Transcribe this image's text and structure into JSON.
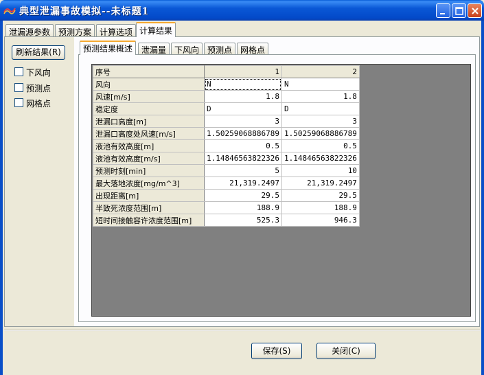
{
  "window": {
    "title": "典型泄漏事故模拟--未标题1"
  },
  "top_tabs": [
    {
      "label": "泄漏源参数"
    },
    {
      "label": "预测方案"
    },
    {
      "label": "计算选项"
    },
    {
      "label": "计算结果"
    }
  ],
  "left": {
    "refresh_label": "刷新结果(R)",
    "checkboxes": [
      {
        "label": "下风向",
        "checked": false
      },
      {
        "label": "预测点",
        "checked": false
      },
      {
        "label": "网格点",
        "checked": false
      }
    ]
  },
  "inner_tabs": [
    {
      "label": "预测结果概述"
    },
    {
      "label": "泄漏量"
    },
    {
      "label": "下风向"
    },
    {
      "label": "预测点"
    },
    {
      "label": "网格点"
    }
  ],
  "grid": {
    "header": {
      "label": "序号",
      "cols": [
        "1",
        "2"
      ]
    },
    "rows": [
      {
        "label": "风向",
        "values": [
          "N",
          "N"
        ]
      },
      {
        "label": "风速[m/s]",
        "values": [
          "1.8",
          "1.8"
        ]
      },
      {
        "label": "稳定度",
        "values": [
          "D",
          "D"
        ]
      },
      {
        "label": "泄漏口高度[m]",
        "values": [
          "3",
          "3"
        ]
      },
      {
        "label": "泄漏口高度处风速[m/s]",
        "values": [
          "1.50259068886789",
          "1.50259068886789"
        ]
      },
      {
        "label": "液池有效高度[m]",
        "values": [
          "0.5",
          "0.5"
        ]
      },
      {
        "label": "液池有效高度[m/s]",
        "values": [
          "1.14846563822326",
          "1.14846563822326"
        ]
      },
      {
        "label": "预测时刻[min]",
        "values": [
          "5",
          "10"
        ]
      },
      {
        "label": "最大落地浓度[mg/m^3]",
        "values": [
          "21,319.2497",
          "21,319.2497"
        ]
      },
      {
        "label": "出现距离[m]",
        "values": [
          "29.5",
          "29.5"
        ]
      },
      {
        "label": "半致死浓度范围[m]",
        "values": [
          "188.9",
          "188.9"
        ]
      },
      {
        "label": "短时间接触容许浓度范围[m]",
        "values": [
          "525.3",
          "946.3"
        ]
      }
    ]
  },
  "buttons": {
    "save": "保存(S)",
    "close": "关闭(C)"
  },
  "colors": {
    "titlebar": "#0a58d6",
    "active_tab_accent": "#f5a930",
    "grid_bg": "#808080"
  }
}
